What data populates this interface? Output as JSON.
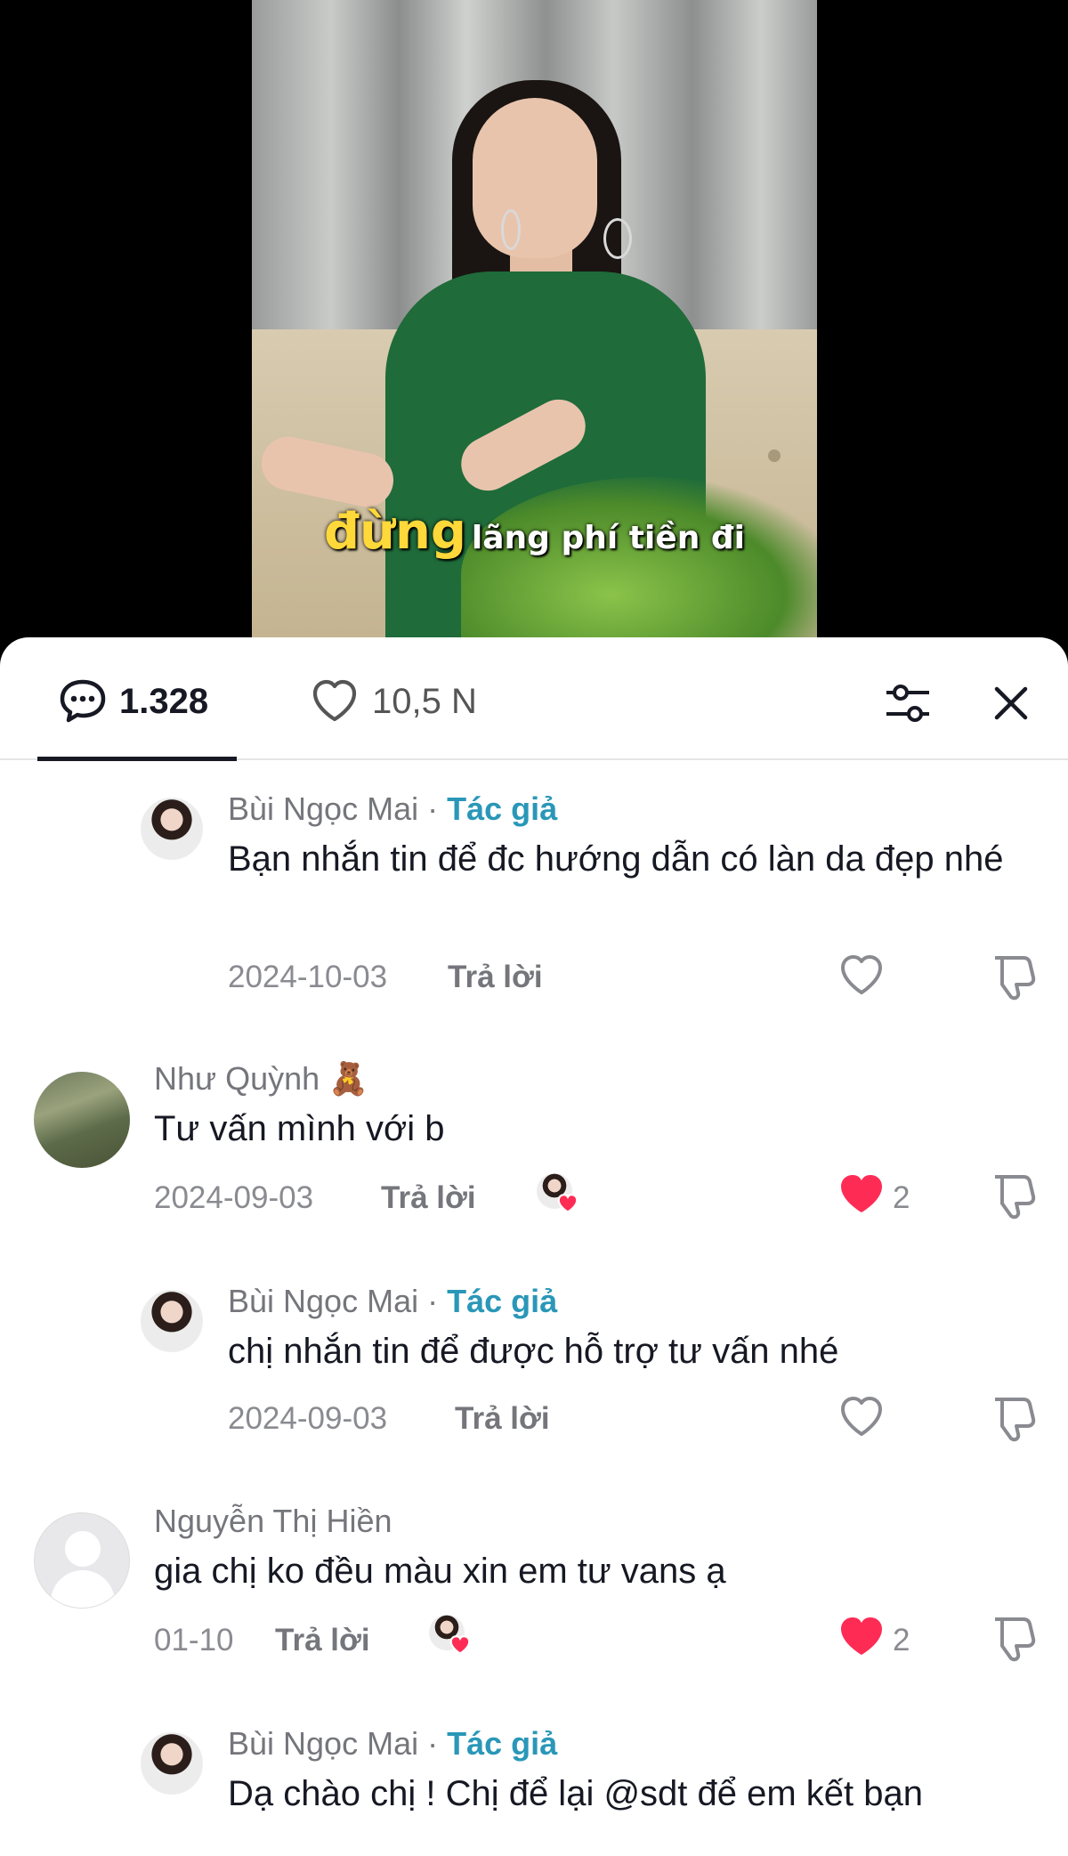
{
  "video": {
    "caption_highlight": "đừng",
    "caption_rest": "lãng phí tiền đi"
  },
  "header": {
    "comment_count": "1.328",
    "like_count": "10,5 N"
  },
  "icons": {
    "comments": "comment-bubble-icon",
    "likes": "heart-outline-icon",
    "filter": "sliders-icon",
    "close": "close-icon",
    "reply_like": "heart-icon",
    "reply_dislike": "thumbs-down-icon"
  },
  "colors": {
    "author_tag": "#2a97b8",
    "liked_heart": "#fe2c55",
    "caption_highlight": "#ffd83a"
  },
  "comments": [
    {
      "name": "Bùi Ngọc Mai",
      "author_tag": "Tác giả",
      "text": "Bạn nhắn tin để đc hướng dẫn có làn da đẹp nhé",
      "date": "2024-10-03",
      "reply": "Trả lời",
      "liked": false,
      "likes": ""
    },
    {
      "name": "Như Quỳnh 🧸",
      "text": "Tư vấn mình với b",
      "date": "2024-09-03",
      "reply": "Trả lời",
      "liked": true,
      "likes": "2"
    },
    {
      "name": "Bùi Ngọc Mai",
      "author_tag": "Tác giả",
      "text": "chị nhắn tin để được hỗ trợ tư vấn nhé",
      "date": "2024-09-03",
      "reply": "Trả lời",
      "liked": false,
      "likes": ""
    },
    {
      "name": "Nguyễn Thị Hiền",
      "text": "gia chị ko đều màu xin em tư vans ạ",
      "date": "01-10",
      "reply": "Trả lời",
      "liked": true,
      "likes": "2"
    },
    {
      "name": "Bùi Ngọc Mai",
      "author_tag": "Tác giả",
      "text": "Dạ chào chị ! Chị để lại @sdt để em kết bạn"
    }
  ]
}
